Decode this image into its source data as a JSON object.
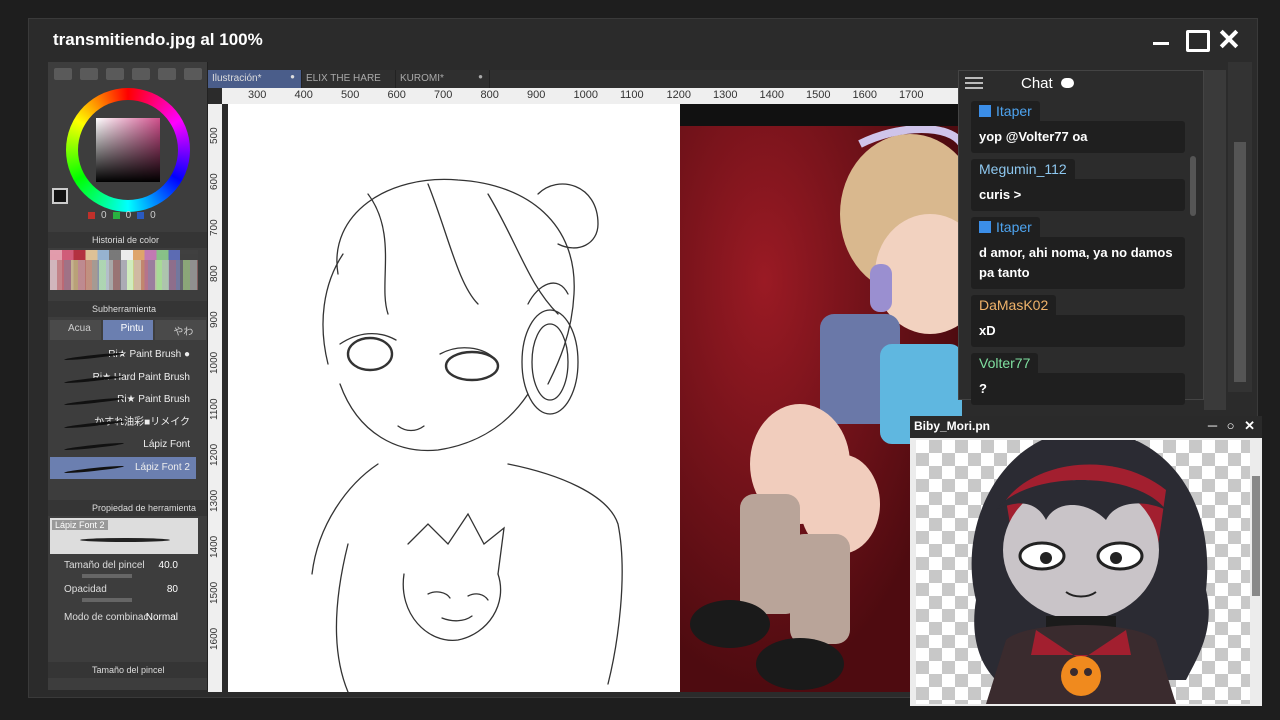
{
  "window": {
    "title": "transmitiendo.jpg al 100%"
  },
  "leftpanel": {
    "rgb": [
      "0",
      "0",
      "0"
    ],
    "color_history_label": "Historial de color",
    "subtool_label": "Subherramienta",
    "subtool_tabs": [
      "Acua",
      "Pintu",
      "やわ"
    ],
    "brushes": [
      "Ri★ Paint Brush ●",
      "Ri★ Hard Paint Brush",
      "Ri★ Paint Brush",
      "かすれ油彩■リメイク",
      "Lápiz Font",
      "Lápiz Font 2"
    ],
    "tool_property_label": "Propiedad de herramienta",
    "current_tool": "Lápiz Font 2",
    "brush_size_label": "Tamaño del pincel",
    "brush_size_value": "40.0",
    "opacity_label": "Opacidad",
    "opacity_value": "80",
    "blend_label": "Modo de combinac",
    "blend_value": "Normal",
    "bottom_panel_label": "Tamaño del pincel"
  },
  "tabs": [
    {
      "label": "Ilustración*"
    },
    {
      "label": "ELIX THE HARE"
    },
    {
      "label": "KUROMI*"
    }
  ],
  "ruler": {
    "top": [
      "300",
      "400",
      "500",
      "600",
      "700",
      "800",
      "900",
      "1000",
      "1100",
      "1200",
      "1300",
      "1400",
      "1500",
      "1600",
      "1700"
    ],
    "left": [
      "500",
      "600",
      "700",
      "800",
      "900",
      "1000",
      "1100",
      "1200",
      "1300",
      "1400",
      "1500",
      "1600"
    ]
  },
  "chat": {
    "title": "Chat",
    "messages": [
      {
        "user": "Itaper",
        "color": "#4ea4f0",
        "badge": true,
        "text": "yop @Volter77 oa"
      },
      {
        "user": "Megumin_112",
        "color": "#8ec8f0",
        "badge": false,
        "text": "curis >"
      },
      {
        "user": "Itaper",
        "color": "#4ea4f0",
        "badge": true,
        "text": "d amor, ahi noma, ya no damos pa tanto"
      },
      {
        "user": "DaMasK02",
        "color": "#f0b36a",
        "badge": false,
        "text": "xD"
      },
      {
        "user": "Volter77",
        "color": "#7fe0a0",
        "badge": false,
        "text": "?"
      }
    ]
  },
  "avatar_window": {
    "title": "Biby_Mori.pn",
    "controls": "─ ○ ✕"
  }
}
